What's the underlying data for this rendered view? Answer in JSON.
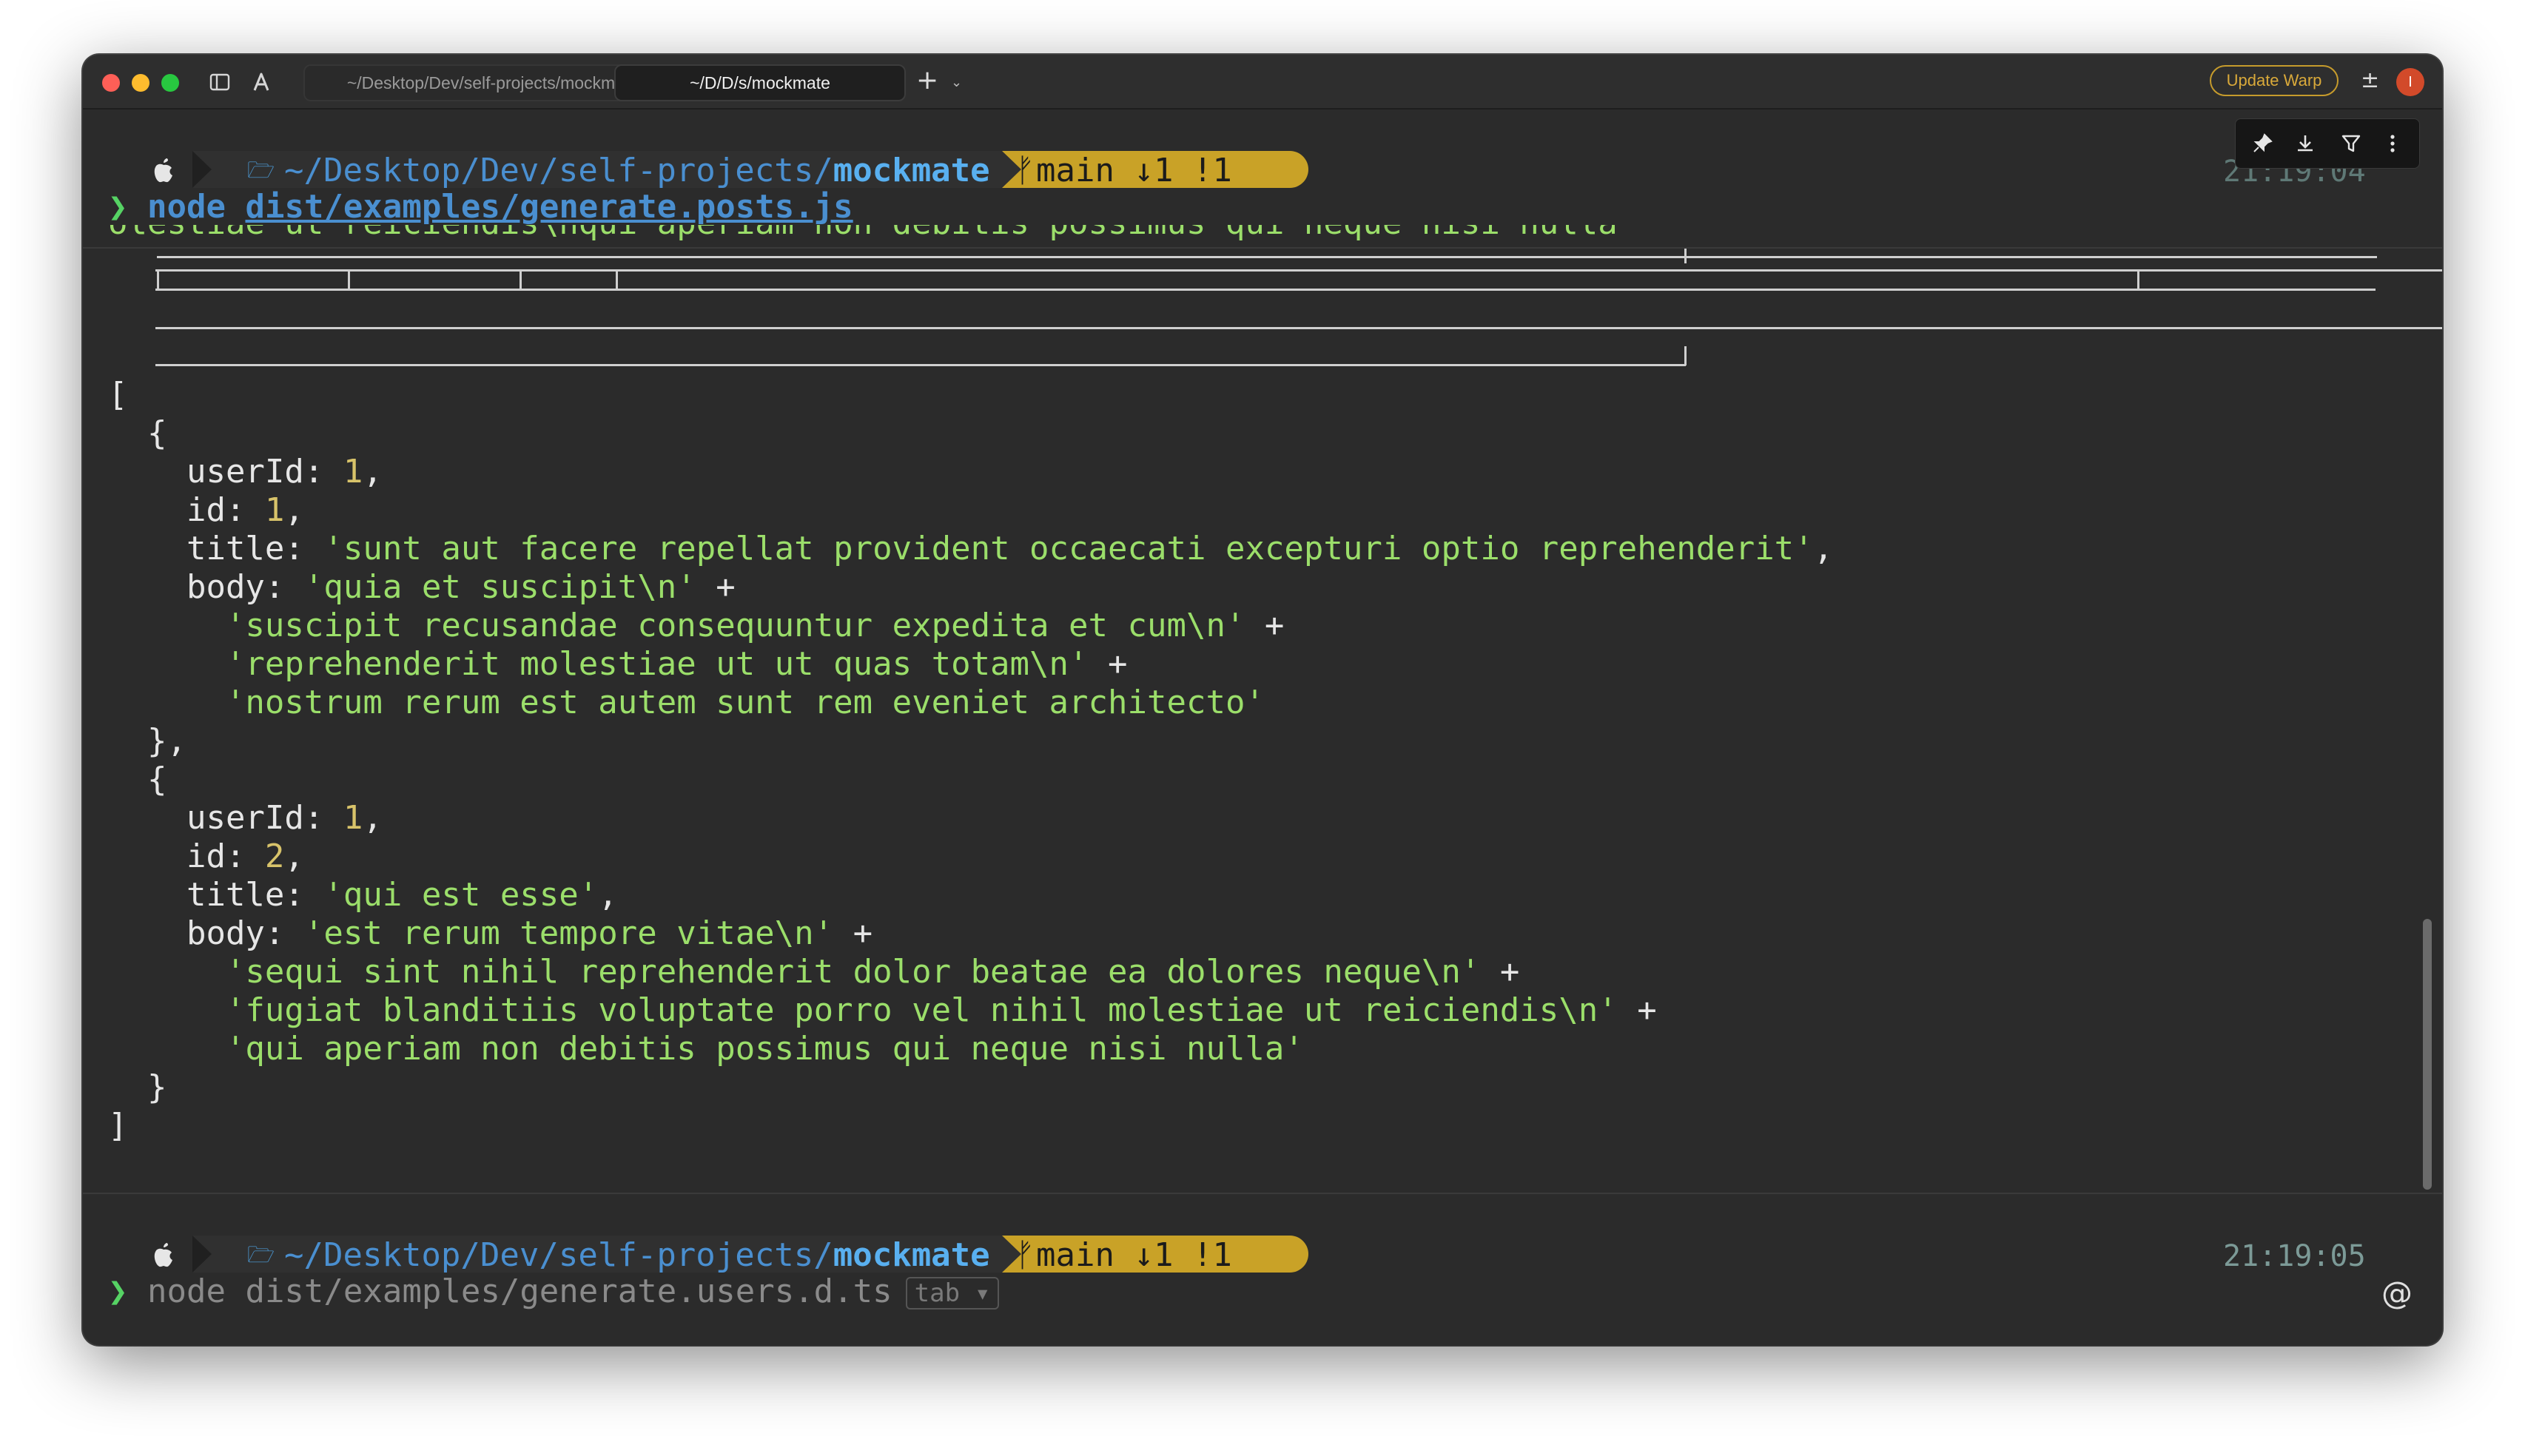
{
  "window": {
    "tabs": [
      {
        "label": "~/Desktop/Dev/self-projects/mockmate",
        "active": false
      },
      {
        "label": "~/D/D/s/mockmate",
        "active": true
      }
    ],
    "update_button": "Update Warp",
    "avatar_letter": "I",
    "accent_color": "#c9a227"
  },
  "block1": {
    "prompt": {
      "path_prefix": "~/Desktop/Dev/self-projects/",
      "path_dir": "mockmate",
      "git": "main ↓1 !1",
      "timestamp": "21:19:04"
    },
    "command_caret": "❯",
    "command_node": "node",
    "command_file": "dist/examples/generate.posts.js",
    "clipped_line": "olestiae ut reiciendis\\nqui aperiam non debitis possimus qui neque nisi nulla"
  },
  "output_lines": [
    [
      [
        "p",
        "["
      ]
    ],
    [
      [
        "p",
        "  {"
      ]
    ],
    [
      [
        "k",
        "    userId: "
      ],
      [
        "n",
        "1"
      ],
      [
        "p",
        ","
      ]
    ],
    [
      [
        "k",
        "    id: "
      ],
      [
        "n",
        "1"
      ],
      [
        "p",
        ","
      ]
    ],
    [
      [
        "k",
        "    title: "
      ],
      [
        "s",
        "'sunt aut facere repellat provident occaecati excepturi optio reprehenderit'"
      ],
      [
        "p",
        ","
      ]
    ],
    [
      [
        "k",
        "    body: "
      ],
      [
        "s",
        "'quia et suscipit\\n'"
      ],
      [
        "p",
        " +"
      ]
    ],
    [
      [
        "s",
        "      'suscipit recusandae consequuntur expedita et cum\\n'"
      ],
      [
        "p",
        " +"
      ]
    ],
    [
      [
        "s",
        "      'reprehenderit molestiae ut ut quas totam\\n'"
      ],
      [
        "p",
        " +"
      ]
    ],
    [
      [
        "s",
        "      'nostrum rerum est autem sunt rem eveniet architecto'"
      ]
    ],
    [
      [
        "p",
        "  },"
      ]
    ],
    [
      [
        "p",
        "  {"
      ]
    ],
    [
      [
        "k",
        "    userId: "
      ],
      [
        "n",
        "1"
      ],
      [
        "p",
        ","
      ]
    ],
    [
      [
        "k",
        "    id: "
      ],
      [
        "n",
        "2"
      ],
      [
        "p",
        ","
      ]
    ],
    [
      [
        "k",
        "    title: "
      ],
      [
        "s",
        "'qui est esse'"
      ],
      [
        "p",
        ","
      ]
    ],
    [
      [
        "k",
        "    body: "
      ],
      [
        "s",
        "'est rerum tempore vitae\\n'"
      ],
      [
        "p",
        " +"
      ]
    ],
    [
      [
        "s",
        "      'sequi sint nihil reprehenderit dolor beatae ea dolores neque\\n'"
      ],
      [
        "p",
        " +"
      ]
    ],
    [
      [
        "s",
        "      'fugiat blanditiis voluptate porro vel nihil molestiae ut reiciendis\\n'"
      ],
      [
        "p",
        " +"
      ]
    ],
    [
      [
        "s",
        "      'qui aperiam non debitis possimus qui neque nisi nulla'"
      ]
    ],
    [
      [
        "p",
        "  }"
      ]
    ],
    [
      [
        "p",
        "]"
      ]
    ]
  ],
  "block2": {
    "prompt": {
      "path_prefix": "~/Desktop/Dev/self-projects/",
      "path_dir": "mockmate",
      "git": "main ↓1 !1",
      "timestamp": "21:19:05"
    },
    "command_caret": "❯",
    "suggestion": "node dist/examples/generate.users.d.ts",
    "tab_hint": "tab ▾"
  }
}
